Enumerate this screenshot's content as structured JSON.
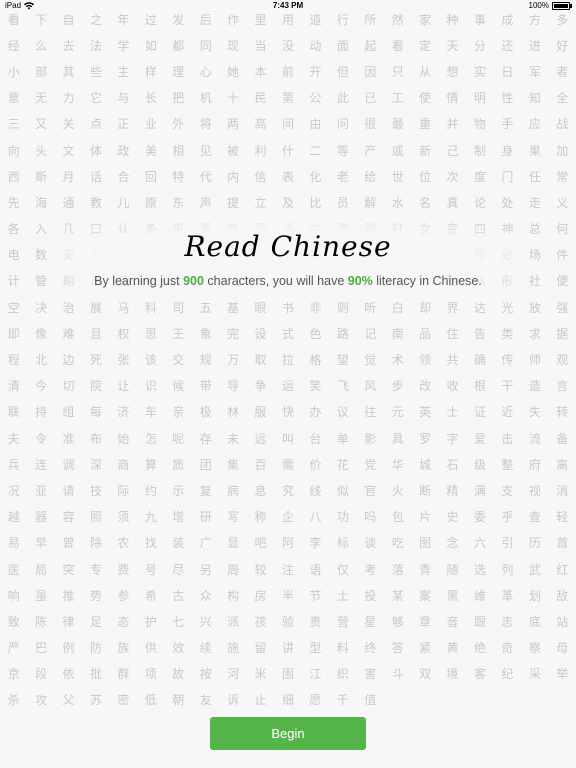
{
  "status": {
    "carrier": "iPad",
    "time": "7:43 PM",
    "battery": "100%"
  },
  "background_chars": [
    "看下自之年过发后作里用道行所然家种事成方",
    "多经么去法学如都同现当没动面起看定天分还",
    "进好小部其些主样理心她本前开但因只从想实",
    "日军者意无力它与长把机十民第公此已工使情",
    "明性知全三又关点正业外将两高间由问很最重",
    "并物手应战向头文体政美相见被利什二等产或",
    "新己制身果加西斯月话合回特代内信表化老给",
    "世位次度门任常先海通教儿原东声提立及比员",
    "解水名真论处走义各入几口认条平系气题活尔",
    "更别打女变四神总何电数安少报才结反受目太",
    "量再感建务做接必场件计管期市直德资命山金",
    "指克许统区保至队形社便空决治展马科司五基",
    "眼书非则听白却界达光放强即像难且权思王象",
    "完设式色路记南品住告类求据程北边死张该交",
    "规万取拉格望觉术领共确传师观清今切院让识",
    "候带导争运笑飞风步改收根干造言联持组每济",
    "车亲极林服快办议往元英士证近失转夫令准布",
    "始怎呢存未远叫台单影具罗字爱击流备兵连调",
    "深商算质团集百需价花党华城石级整府离况亚",
    "请技际约示复病息究线似官火断精满支视消越",
    "器容照须九增研写称企八功吗包片史委乎查轻",
    "易早曾除农找装广显吧阿李标谈吃图念六引历",
    "首医局突专费号尽另周较注语仅考落青随选列",
    "武红响虽推势参希古众构房半节土投某案黑维",
    "革划敌致陈律足态护七兴派孩验责营星够章音",
    "跟志底站严巴例防族供效续施留讲型料终答紧",
    "黄绝奇察母京段依批群项故按河米围江织害斗",
    "双境客纪采举杀攻父苏密低朝友诉止细愿千值"
  ],
  "logo": {
    "text": "Read Chinese"
  },
  "tagline": {
    "prefix": "By learning just ",
    "chars_count": "900",
    "middle": " characters, you will have ",
    "literacy": "90%",
    "suffix": " literacy in Chinese."
  },
  "begin_button": {
    "label": "Begin"
  },
  "colors": {
    "accent_green": "#56b54a",
    "highlight_green": "#4caf3a",
    "background": "#f7f7f9",
    "char_gray": "#c9c9cc"
  }
}
